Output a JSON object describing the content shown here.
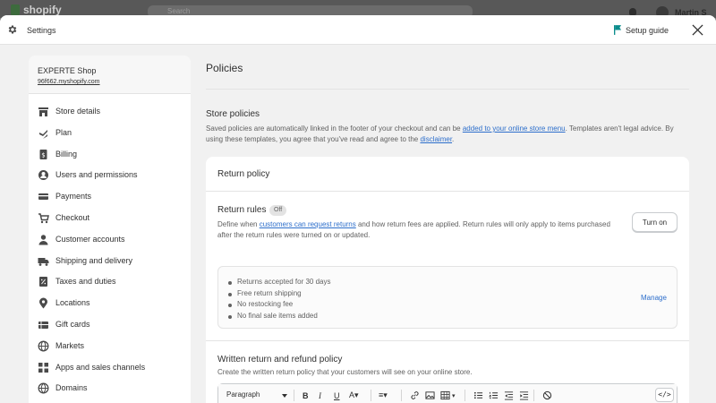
{
  "background": {
    "logo_text": "shopify",
    "search_placeholder": "Search",
    "user_name": "Martin S"
  },
  "header": {
    "title": "Settings",
    "setup_guide": "Setup guide"
  },
  "sidebar": {
    "shop_name": "EXPERTE Shop",
    "shop_url": "96f662.myshopify.com",
    "items": [
      {
        "label": "Store details",
        "icon": "store-icon"
      },
      {
        "label": "Plan",
        "icon": "plan-icon"
      },
      {
        "label": "Billing",
        "icon": "billing-icon"
      },
      {
        "label": "Users and permissions",
        "icon": "user-circle-icon"
      },
      {
        "label": "Payments",
        "icon": "payments-icon"
      },
      {
        "label": "Checkout",
        "icon": "cart-icon"
      },
      {
        "label": "Customer accounts",
        "icon": "person-icon"
      },
      {
        "label": "Shipping and delivery",
        "icon": "truck-icon"
      },
      {
        "label": "Taxes and duties",
        "icon": "tax-icon"
      },
      {
        "label": "Locations",
        "icon": "location-pin-icon"
      },
      {
        "label": "Gift cards",
        "icon": "gift-card-icon"
      },
      {
        "label": "Markets",
        "icon": "globe-icon"
      },
      {
        "label": "Apps and sales channels",
        "icon": "apps-icon"
      },
      {
        "label": "Domains",
        "icon": "domain-globe-icon"
      }
    ]
  },
  "main": {
    "page_title": "Policies",
    "store_policies": {
      "title": "Store policies",
      "desc_1": "Saved policies are automatically linked in the footer of your checkout and can be ",
      "link_1": "added to your online store menu",
      "desc_2": ". Templates aren't legal advice. By using these templates, you agree that you've read and agree to the ",
      "link_2": "disclaimer",
      "desc_3": "."
    },
    "return_policy": {
      "title": "Return policy",
      "rules_title": "Return rules",
      "rules_badge": "Off",
      "rules_desc_1": "Define when ",
      "rules_link": "customers can request returns",
      "rules_desc_2": " and how return fees are applied. Return rules will only apply to items purchased after the return rules were turned on or updated.",
      "turn_on_label": "Turn on",
      "rules": [
        "Returns accepted for 30 days",
        "Free return shipping",
        "No restocking fee",
        "No final sale items added"
      ],
      "manage_label": "Manage",
      "written_title": "Written return and refund policy",
      "written_desc": "Create the written return policy that your customers will see on your online store.",
      "editor_format": "Paragraph"
    }
  },
  "colors": {
    "link": "#2c6ecb",
    "text": "#303030",
    "muted": "#616161",
    "accent_flag": "#0b8d8d"
  }
}
